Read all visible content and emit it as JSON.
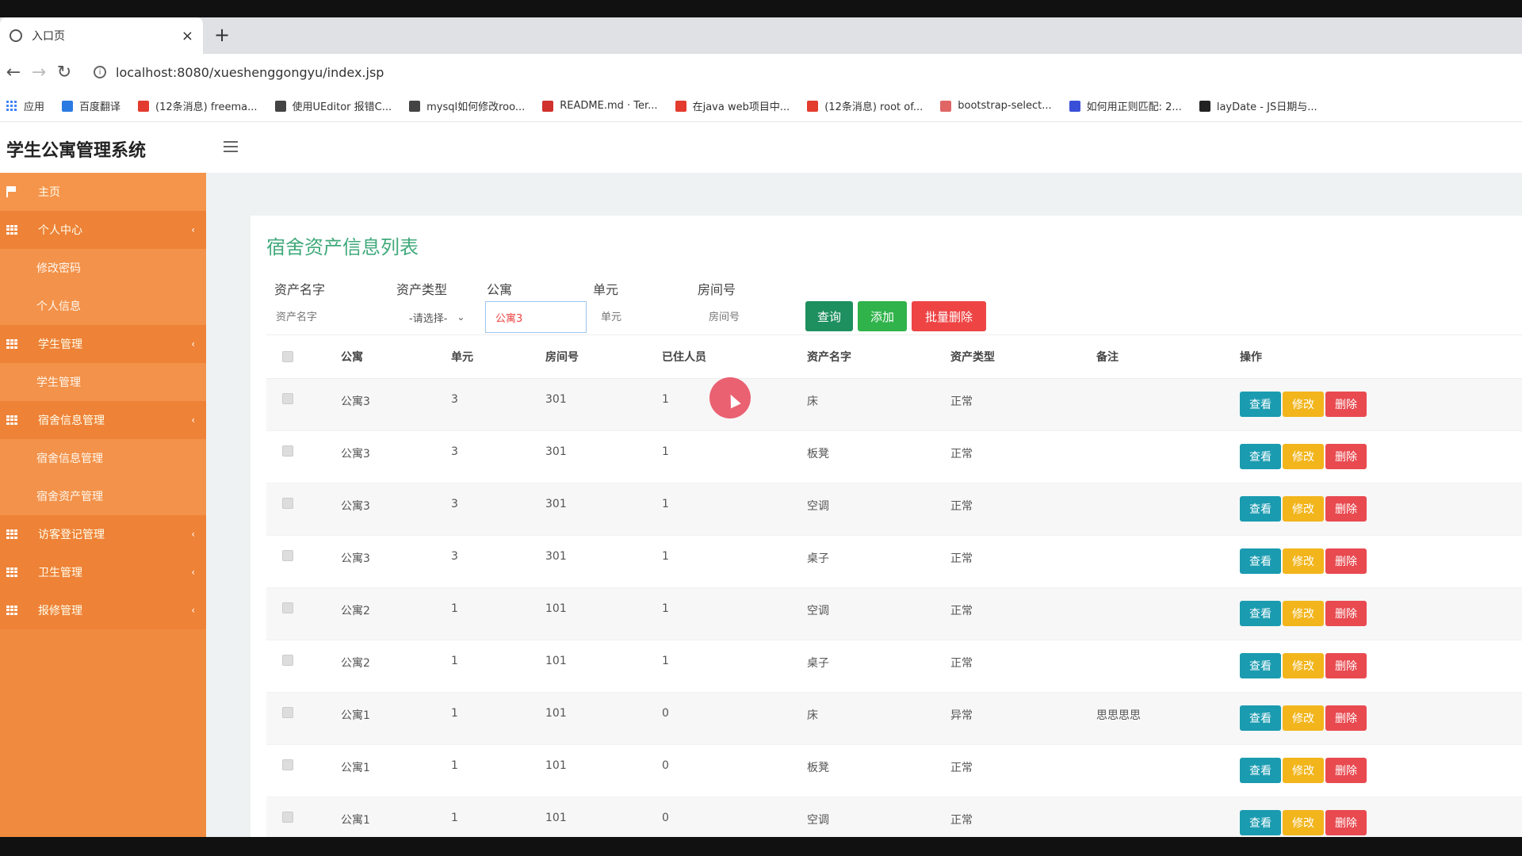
{
  "browser": {
    "tab_title": "入口页",
    "url": "localhost:8080/xueshenggongyu/index.jsp",
    "new_tab_symbol": "+",
    "close_symbol": "×",
    "bookmarks": [
      {
        "label": "应用",
        "color": "#4285f4"
      },
      {
        "label": "百度翻译",
        "color": "#2a7ae2"
      },
      {
        "label": "(12条消息) freema...",
        "color": "#e33b2e"
      },
      {
        "label": "使用UEditor 报错C...",
        "color": "#444444"
      },
      {
        "label": "mysql如何修改roo...",
        "color": "#444444"
      },
      {
        "label": "README.md · Ter...",
        "color": "#d0312d"
      },
      {
        "label": "在java web项目中...",
        "color": "#e33b2e"
      },
      {
        "label": "(12条消息) root of...",
        "color": "#e33b2e"
      },
      {
        "label": "bootstrap-select...",
        "color": "#e06666"
      },
      {
        "label": "如何用正则匹配: 2...",
        "color": "#3a4fd8"
      },
      {
        "label": "layDate - JS日期与...",
        "color": "#222222"
      }
    ]
  },
  "app": {
    "title": "学生公寓管理系统"
  },
  "sidebar": {
    "items": [
      {
        "type": "home",
        "label": "主页"
      },
      {
        "type": "parent",
        "label": "个人中心",
        "arrow": "‹"
      },
      {
        "type": "sub",
        "label": "修改密码"
      },
      {
        "type": "sub",
        "label": "个人信息"
      },
      {
        "type": "parent",
        "label": "学生管理",
        "arrow": "‹"
      },
      {
        "type": "sub",
        "label": "学生管理"
      },
      {
        "type": "parent",
        "label": "宿舍信息管理",
        "arrow": "‹"
      },
      {
        "type": "sub",
        "label": "宿舍信息管理"
      },
      {
        "type": "sub",
        "label": "宿舍资产管理"
      },
      {
        "type": "parent",
        "label": "访客登记管理",
        "arrow": "‹"
      },
      {
        "type": "parent",
        "label": "卫生管理",
        "arrow": "‹"
      },
      {
        "type": "parent",
        "label": "报修管理",
        "arrow": "‹"
      }
    ]
  },
  "page": {
    "title": "宿舍资产信息列表",
    "filters": {
      "asset_name_label": "资产名字",
      "asset_name_placeholder": "资产名字",
      "asset_type_label": "资产类型",
      "asset_type_value": "-请选择-",
      "apartment_label": "公寓",
      "apartment_value": "公寓3",
      "unit_label": "单元",
      "unit_placeholder": "单元",
      "room_label": "房间号",
      "room_placeholder": "房间号"
    },
    "buttons": {
      "query": "查询",
      "add": "添加",
      "batch_delete": "批量删除"
    },
    "colors": {
      "query": "#1e8f5f",
      "add": "#2fb34a",
      "batch_delete": "#ee4444",
      "view": "#1a9bb0",
      "edit": "#f2b51c",
      "delete": "#e84a50"
    },
    "table": {
      "headers": [
        "公寓",
        "单元",
        "房间号",
        "已住人员",
        "资产名字",
        "资产类型",
        "备注",
        "操作"
      ],
      "action_labels": {
        "view": "查看",
        "edit": "修改",
        "delete": "删除"
      },
      "rows": [
        [
          "公寓3",
          "3",
          "301",
          "1",
          "床",
          "正常",
          ""
        ],
        [
          "公寓3",
          "3",
          "301",
          "1",
          "板凳",
          "正常",
          ""
        ],
        [
          "公寓3",
          "3",
          "301",
          "1",
          "空调",
          "正常",
          ""
        ],
        [
          "公寓3",
          "3",
          "301",
          "1",
          "桌子",
          "正常",
          ""
        ],
        [
          "公寓2",
          "1",
          "101",
          "1",
          "空调",
          "正常",
          ""
        ],
        [
          "公寓2",
          "1",
          "101",
          "1",
          "桌子",
          "正常",
          ""
        ],
        [
          "公寓1",
          "1",
          "101",
          "0",
          "床",
          "异常",
          "思思思思"
        ],
        [
          "公寓1",
          "1",
          "101",
          "0",
          "板凳",
          "正常",
          ""
        ],
        [
          "公寓1",
          "1",
          "101",
          "0",
          "空调",
          "正常",
          ""
        ]
      ]
    }
  }
}
